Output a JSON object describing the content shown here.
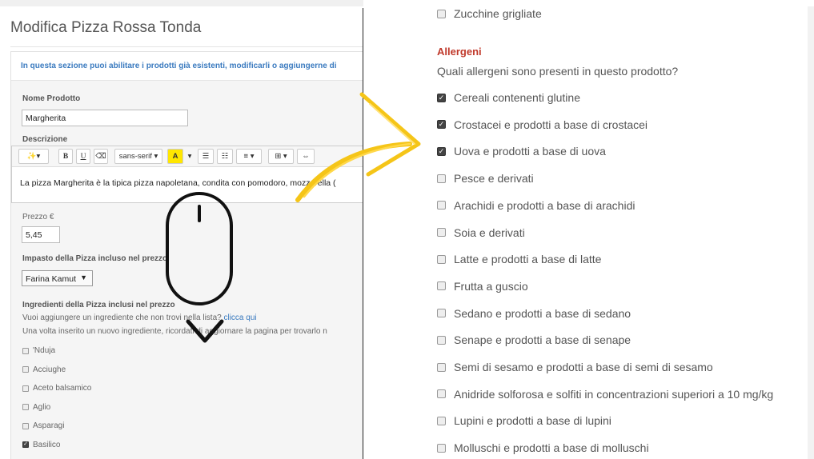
{
  "left": {
    "page_title": "Modifica Pizza Rossa Tonda",
    "info_text": "In questa sezione puoi abilitare i prodotti già esistenti, modificarli o aggiungerne di",
    "name_label": "Nome Prodotto",
    "name_value": "Margherita",
    "description_label": "Descrizione",
    "toolbar": {
      "magic": "✨▾",
      "bold": "B",
      "underline": "U",
      "eraser": "⌫",
      "font": "sans-serif ▾",
      "color": "A",
      "ul": "☰",
      "ol": "☷",
      "align": "≡ ▾",
      "table": "⊞ ▾",
      "link": "⇔"
    },
    "description_text": "La pizza Margherita è la tipica pizza napoletana, condita con pomodoro, mozzarella (",
    "price_label": "Prezzo €",
    "price_value": "5,45",
    "dough_label": "Impasto della Pizza incluso nel prezzo",
    "dough_value": "Farina Kamut",
    "ingredients_label": "Ingredienti della Pizza inclusi nel prezzo",
    "ingredients_hint_prefix": "Vuoi aggiungere un ingrediente che non trovi nella lista?",
    "ingredients_hint_link": "clicca qui",
    "ingredients_hint2": "Una volta inserito un nuovo ingrediente, ricordati di aggiornare la pagina per trovarlo n",
    "ingredients": [
      {
        "label": "'Nduja",
        "checked": false
      },
      {
        "label": "Acciughe",
        "checked": false
      },
      {
        "label": "Aceto balsamico",
        "checked": false
      },
      {
        "label": "Aglio",
        "checked": false
      },
      {
        "label": "Asparagi",
        "checked": false
      },
      {
        "label": "Basilico",
        "checked": true
      }
    ]
  },
  "right": {
    "prev_item": "Zucchine grigliate",
    "allergens_title": "Allergeni",
    "allergens_question": "Quali allergeni sono presenti in questo prodotto?",
    "allergens": [
      {
        "label": "Cereali contenenti glutine",
        "checked": true
      },
      {
        "label": "Crostacei e prodotti a base di crostacei",
        "checked": true
      },
      {
        "label": "Uova e prodotti a base di uova",
        "checked": true
      },
      {
        "label": "Pesce e derivati",
        "checked": false
      },
      {
        "label": "Arachidi e prodotti a base di arachidi",
        "checked": false
      },
      {
        "label": "Soia e derivati",
        "checked": false
      },
      {
        "label": "Latte e prodotti a base di latte",
        "checked": false
      },
      {
        "label": "Frutta a guscio",
        "checked": false
      },
      {
        "label": "Sedano e prodotti a base di sedano",
        "checked": false
      },
      {
        "label": "Senape e prodotti a base di senape",
        "checked": false
      },
      {
        "label": "Semi di sesamo e prodotti a base di semi di sesamo",
        "checked": false
      },
      {
        "label": "Anidride solforosa e solfiti in concentrazioni superiori a 10 mg/kg",
        "checked": false
      },
      {
        "label": "Lupini e prodotti a base di lupini",
        "checked": false
      },
      {
        "label": "Molluschi e prodotti a base di molluschi",
        "checked": false
      }
    ]
  },
  "colors": {
    "accent_link": "#3a7abf",
    "allergen_title": "#c0392b",
    "arrow": "#f5c518"
  },
  "icons": {
    "mouse": "mouse-scroll-icon",
    "arrow": "curved-arrow-icon"
  }
}
